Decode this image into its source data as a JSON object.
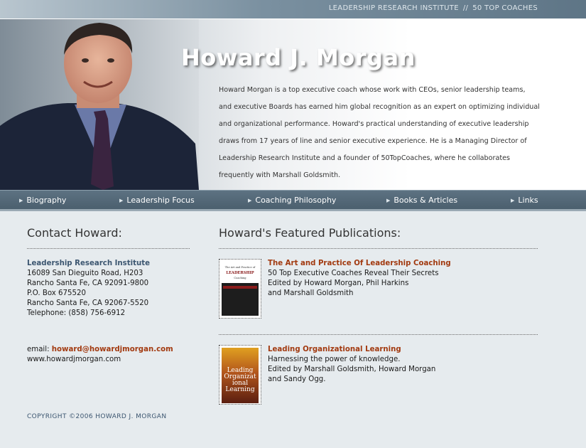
{
  "topbar": {
    "link1": "LEADERSHIP RESEARCH INSTITUTE",
    "separator": "//",
    "link2": "50 TOP COACHES"
  },
  "header": {
    "name": "Howard J. Morgan",
    "bio_lines": [
      "Howard Morgan is a top executive coach whose work with CEOs, senior leadership teams,",
      "and executive Boards has earned him global recognition as an expert on optimizing individual",
      "and organizational performance. Howard's practical understanding of executive leadership",
      "draws from 17 years of line and senior executive experience. He is a Managing Director of",
      "Leadership Research Institute and a founder of 50TopCoaches, where he collaborates",
      "frequently with Marshall Goldsmith."
    ]
  },
  "nav": {
    "items": [
      "Biography",
      "Leadership Focus",
      "Coaching Philosophy",
      "Books & Articles",
      "Links"
    ]
  },
  "contact": {
    "heading": "Contact Howard:",
    "org": "Leadership Research Institute",
    "lines": [
      "16089 San Dieguito Road, H203",
      "Rancho Santa Fe, CA 92091-9800",
      "P.O. Box 675520",
      "Rancho Santa Fe, CA  92067-5520",
      "Telephone: (858) 756-6912"
    ],
    "email_label": "email: ",
    "email": "howard@howardjmorgan.com",
    "website": "www.howardjmorgan.com",
    "copyright": "COPYRIGHT ©2006 HOWARD J. MORGAN"
  },
  "publications": {
    "heading": "Howard's Featured Publications:",
    "items": [
      {
        "title": "The Art and Practice Of Leadership Coaching",
        "lines": [
          "50 Top Executive Coaches Reveal Their Secrets",
          "Edited by Howard Morgan, Phil Harkins",
          "and Marshall Goldsmith"
        ],
        "cover_text": [
          "The Art and Practice of",
          "LEADERSHIP",
          "Coaching"
        ]
      },
      {
        "title": "Leading Organizational Learning",
        "lines": [
          "Harnessing the power of knowledge.",
          "Edited by Marshall Goldsmith, Howard Morgan",
          "and Sandy Ogg."
        ],
        "cover_text": [
          "Leading",
          "Organizat",
          "ional",
          "Learning"
        ]
      }
    ]
  }
}
